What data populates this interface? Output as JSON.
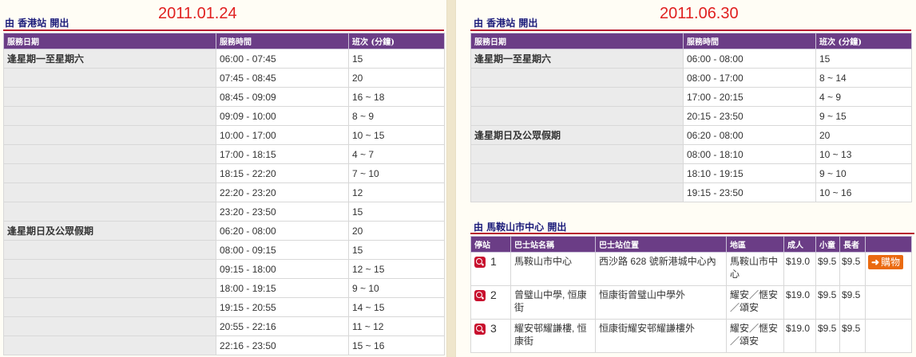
{
  "left": {
    "date": "2011.01.24",
    "section_title": "由 香港站 開出",
    "headers": [
      "服務日期",
      "服務時間",
      "班次 (分鐘)"
    ],
    "rows": [
      {
        "day": "逢星期一至星期六",
        "time": "06:00 - 07:45",
        "freq": "15"
      },
      {
        "day": "",
        "time": "07:45 - 08:45",
        "freq": "20"
      },
      {
        "day": "",
        "time": "08:45 - 09:09",
        "freq": "16 ~ 18"
      },
      {
        "day": "",
        "time": "09:09 - 10:00",
        "freq": "8 ~ 9"
      },
      {
        "day": "",
        "time": "10:00 - 17:00",
        "freq": "10 ~ 15"
      },
      {
        "day": "",
        "time": "17:00 - 18:15",
        "freq": "4 ~ 7"
      },
      {
        "day": "",
        "time": "18:15 - 22:20",
        "freq": "7 ~ 10"
      },
      {
        "day": "",
        "time": "22:20 - 23:20",
        "freq": "12"
      },
      {
        "day": "",
        "time": "23:20 - 23:50",
        "freq": "15"
      },
      {
        "day": "逢星期日及公眾假期",
        "time": "06:20 - 08:00",
        "freq": "20"
      },
      {
        "day": "",
        "time": "08:00 - 09:15",
        "freq": "15"
      },
      {
        "day": "",
        "time": "09:15 - 18:00",
        "freq": "12 ~ 15"
      },
      {
        "day": "",
        "time": "18:00 - 19:15",
        "freq": "9 ~ 10"
      },
      {
        "day": "",
        "time": "19:15 - 20:55",
        "freq": "14 ~ 15"
      },
      {
        "day": "",
        "time": "20:55 - 22:16",
        "freq": "11 ~ 12"
      },
      {
        "day": "",
        "time": "22:16 - 23:50",
        "freq": "15 ~ 16"
      }
    ]
  },
  "right": {
    "date": "2011.06.30",
    "section_title": "由 香港站 開出",
    "headers": [
      "服務日期",
      "服務時間",
      "班次 (分鐘)"
    ],
    "rows": [
      {
        "day": "逢星期一至星期六",
        "time": "06:00 - 08:00",
        "freq": "15"
      },
      {
        "day": "",
        "time": "08:00 - 17:00",
        "freq": "8 ~ 14"
      },
      {
        "day": "",
        "time": "17:00 - 20:15",
        "freq": "4 ~ 9"
      },
      {
        "day": "",
        "time": "20:15 - 23:50",
        "freq": "9 ~ 15"
      },
      {
        "day": "逢星期日及公眾假期",
        "time": "06:20 - 08:00",
        "freq": "20"
      },
      {
        "day": "",
        "time": "08:00 - 18:10",
        "freq": "10 ~ 13"
      },
      {
        "day": "",
        "time": "18:10 - 19:15",
        "freq": "9 ~ 10"
      },
      {
        "day": "",
        "time": "19:15 - 23:50",
        "freq": "10 ~ 16"
      }
    ],
    "stops_title": "由 馬鞍山市中心 開出",
    "stops_headers": [
      "停站",
      "巴士站名稱",
      "巴士站位置",
      "地區",
      "成人",
      "小童",
      "長者",
      ""
    ],
    "stops": [
      {
        "num": "1",
        "name": "馬鞍山市中心",
        "location": "西沙路 628 號新港城中心內",
        "district": "馬鞍山市中心",
        "adult": "$19.0",
        "child": "$9.5",
        "senior": "$9.5",
        "buy": "購物"
      },
      {
        "num": "2",
        "name": "曾璧山中學, 恒康街",
        "location": "恒康街曾璧山中學外",
        "district": "耀安／愜安／頌安",
        "adult": "$19.0",
        "child": "$9.5",
        "senior": "$9.5",
        "buy": ""
      },
      {
        "num": "3",
        "name": "耀安邨耀謙樓, 恒康街",
        "location": "恒康街耀安邨耀謙樓外",
        "district": "耀安／愜安／頌安",
        "adult": "$19.0",
        "child": "$9.5",
        "senior": "$9.5",
        "buy": ""
      }
    ]
  },
  "colors": {
    "header_bg": "#6b3d86",
    "rule": "#b81c30",
    "date": "#e02020",
    "title": "#1a1a7a",
    "buy": "#ea6a10"
  }
}
